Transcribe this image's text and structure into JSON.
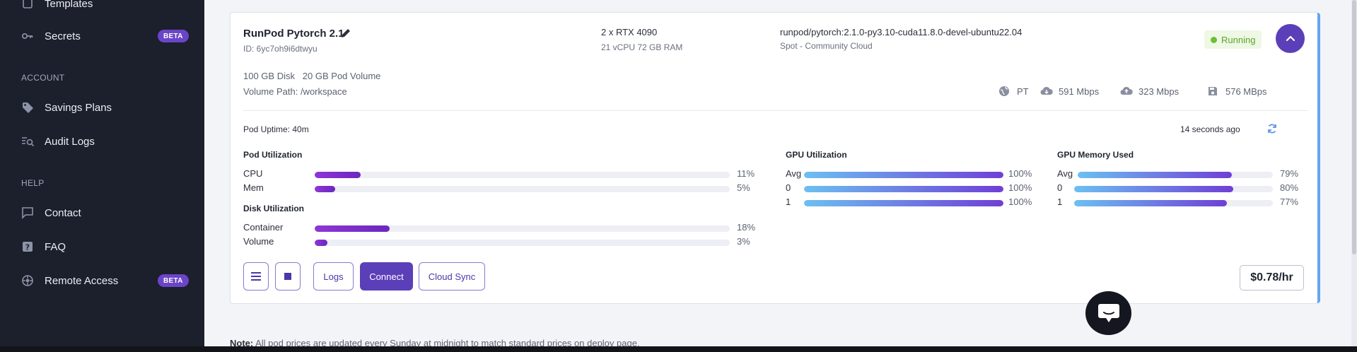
{
  "sidebar": {
    "items": [
      {
        "label": "Templates",
        "icon": "template-icon"
      },
      {
        "label": "Secrets",
        "icon": "key-icon",
        "badge": "BETA"
      },
      {
        "label": "Savings Plans",
        "icon": "tag-icon"
      },
      {
        "label": "Audit Logs",
        "icon": "audit-log-icon"
      },
      {
        "label": "Contact",
        "icon": "chat-bubble-icon"
      },
      {
        "label": "FAQ",
        "icon": "question-icon"
      },
      {
        "label": "Remote Access",
        "icon": "remote-access-icon",
        "badge": "BETA"
      }
    ],
    "sections": {
      "account": "ACCOUNT",
      "help": "HELP"
    }
  },
  "pod": {
    "name": "RunPod Pytorch 2.1",
    "id": "ID: 6yc7oh9i6dtwyu",
    "gpu": "2 x RTX 4090",
    "gpu_sub": "21 vCPU 72 GB RAM",
    "image": "runpod/pytorch:2.1.0-py3.10-cuda11.8.0-devel-ubuntu22.04",
    "image_sub": "Spot - Community Cloud",
    "status": "Running",
    "disk": "100 GB Disk   20 GB Pod Volume",
    "volume_path": "Volume Path: /workspace",
    "network": {
      "region": "PT",
      "download": "591 Mbps",
      "upload": "323 Mbps",
      "disk_speed": "576 MBps"
    },
    "uptime": "Pod Uptime: 40m",
    "updated": "14 seconds ago",
    "price": "$0.78/hr"
  },
  "pod_util": {
    "title": "Pod Utilization",
    "rows": [
      {
        "label": "CPU",
        "pct": "11%",
        "value": 11
      },
      {
        "label": "Mem",
        "pct": "5%",
        "value": 5
      }
    ]
  },
  "disk_util": {
    "title": "Disk Utilization",
    "rows": [
      {
        "label": "Container",
        "pct": "18%",
        "value": 18
      },
      {
        "label": "Volume",
        "pct": "3%",
        "value": 3
      }
    ]
  },
  "gpu_util": {
    "title": "GPU Utilization",
    "rows": [
      {
        "label": "Avg",
        "pct": "100%",
        "value": 100
      },
      {
        "label": "0",
        "pct": "100%",
        "value": 100
      },
      {
        "label": "1",
        "pct": "100%",
        "value": 100
      }
    ]
  },
  "gpu_mem": {
    "title": "GPU Memory Used",
    "rows": [
      {
        "label": "Avg",
        "pct": "79%",
        "value": 79
      },
      {
        "label": "0",
        "pct": "80%",
        "value": 80
      },
      {
        "label": "1",
        "pct": "77%",
        "value": 77
      }
    ]
  },
  "actions": {
    "logs": "Logs",
    "connect": "Connect",
    "cloud_sync": "Cloud Sync"
  },
  "note": {
    "label": "Note:",
    "text": " All pod prices are updated every Sunday at midnight to match standard prices on deploy page."
  },
  "colors": {
    "accent": "#5b3fb8",
    "running": "#5aa52b",
    "sidebar": "#1c1f2c"
  }
}
